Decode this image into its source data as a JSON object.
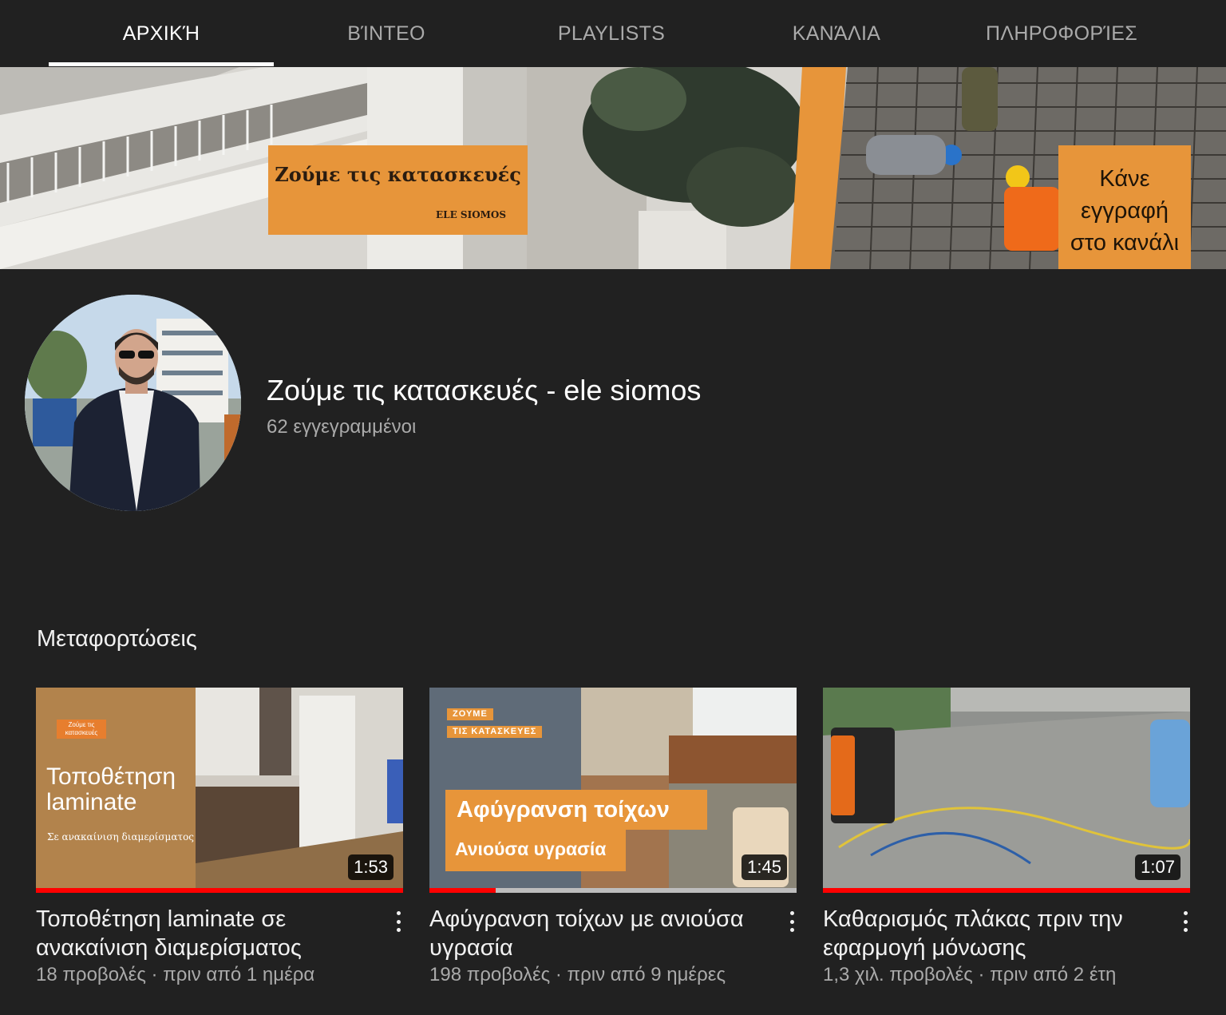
{
  "tabs": [
    {
      "label": "ΑΡΧΙΚΉ",
      "active": true
    },
    {
      "label": "ΒΊΝΤΕΟ",
      "active": false
    },
    {
      "label": "PLAYLISTS",
      "active": false
    },
    {
      "label": "ΚΑΝΆΛΙΑ",
      "active": false
    },
    {
      "label": "ΠΛΗΡΟΦΟΡΊΕΣ",
      "active": false
    }
  ],
  "banner": {
    "title": "Ζούμε τις κατασκευές",
    "subtitle": "ELE SIOMOS",
    "subscribe_text": "Κάνε εγγραφή στο κανάλι",
    "accent_color": "#e7953a"
  },
  "channel": {
    "name": "Ζούμε τις κατασκευές - ele siomos",
    "subscribers": "62 εγγεγραμμένοι"
  },
  "section": {
    "title": "Μεταφορτώσεις"
  },
  "videos": [
    {
      "title": "Τοποθέτηση laminate σε ανακαίνιση διαμερίσματος",
      "meta": "18 προβολές · πριν από 1 ημέρα",
      "duration": "1:53",
      "watched_fraction": 1.0,
      "thumb": {
        "tag": "Ζούμε τις κατασκευές",
        "headline": "Τοποθέτηση laminate",
        "sub": "Σε ανακαίνιση διαμερίσματος"
      }
    },
    {
      "title": "Αφύγρανση τοίχων με ανιούσα υγρασία",
      "meta": "198 προβολές · πριν από 9 ημέρες",
      "duration": "1:45",
      "watched_fraction": 0.18,
      "thumb": {
        "tag1": "ΖΟΥΜΕ",
        "tag2": "ΤΙΣ ΚΑΤΑΣΚΕΥΕΣ",
        "headline": "Αφύγρανση τοίχων",
        "sub": "Ανιούσα υγρασία"
      }
    },
    {
      "title": "Καθαρισμός πλάκας πριν την εφαρμογή μόνωσης",
      "meta": "1,3 χιλ. προβολές · πριν από 2 έτη",
      "duration": "1:07",
      "watched_fraction": 1.0
    }
  ]
}
